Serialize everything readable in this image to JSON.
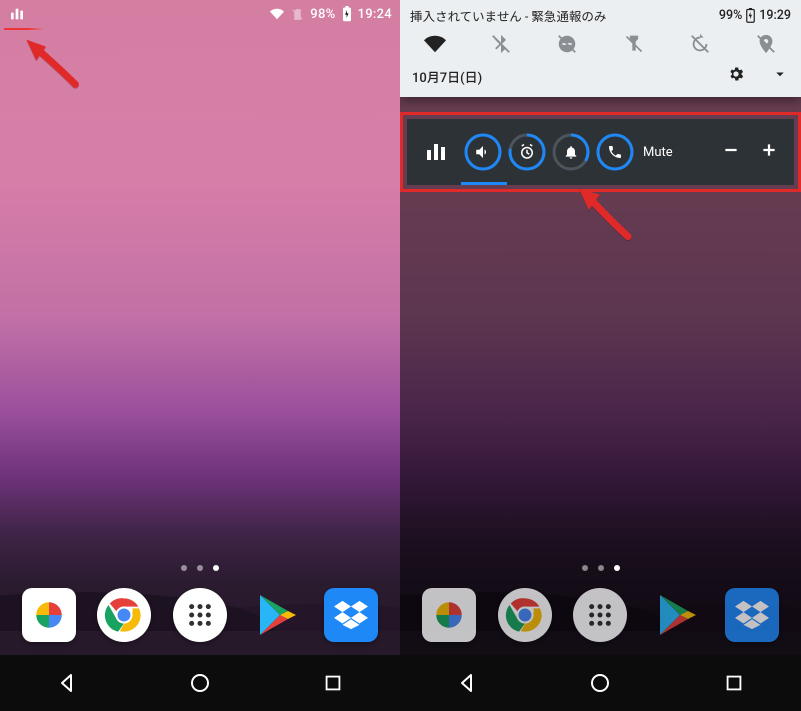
{
  "left": {
    "status": {
      "battery_pct": "98%",
      "time": "19:24"
    },
    "dots": {
      "count": 3,
      "active_index": 2
    }
  },
  "right": {
    "shade": {
      "sim_text": "挿入されていません - 緊急通報のみ",
      "battery_pct": "99%",
      "time": "19:29",
      "date": "10月7日(日)"
    },
    "vol": {
      "label": "Mute",
      "rings": [
        {
          "name": "media",
          "deg": 360
        },
        {
          "name": "alarm",
          "deg": 280
        },
        {
          "name": "notify",
          "deg": 120
        },
        {
          "name": "call",
          "deg": 360
        }
      ]
    },
    "dots": {
      "count": 3,
      "active_index": 2
    }
  },
  "colors": {
    "accent": "#1e88f7",
    "ring_track": "#4c555c",
    "arrow": "#e02a2a"
  }
}
